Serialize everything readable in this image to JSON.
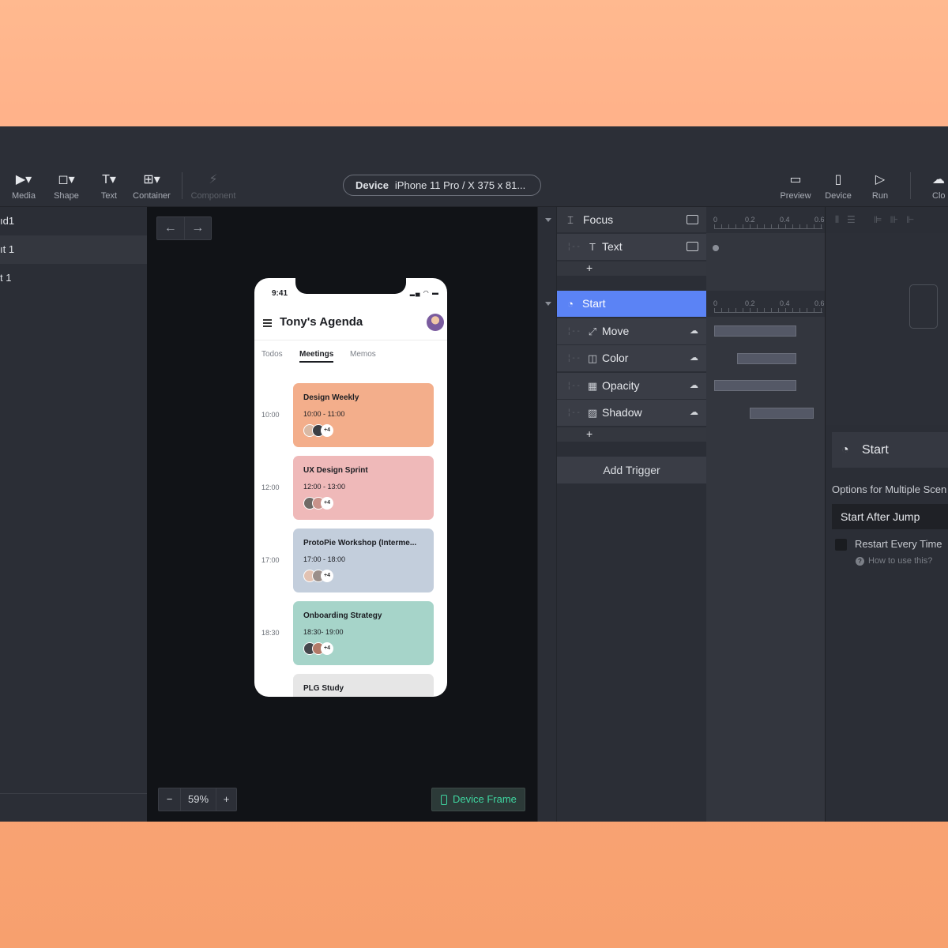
{
  "toolbar": {
    "tools": [
      {
        "label": "Media",
        "icon": "media-icon",
        "glyph": "▶▾"
      },
      {
        "label": "Shape",
        "icon": "shape-icon",
        "glyph": "◻▾"
      },
      {
        "label": "Text",
        "icon": "text-icon",
        "glyph": "T▾"
      },
      {
        "label": "Container",
        "icon": "container-icon",
        "glyph": "⊞▾"
      },
      {
        "label": "Component",
        "icon": "component-icon",
        "glyph": "⚡"
      }
    ],
    "device_label": "Device",
    "device_value": "iPhone 11 Pro / X  375 x 81...",
    "right_tools": [
      {
        "label": "Preview",
        "icon": "preview-icon",
        "glyph": "▭"
      },
      {
        "label": "Device",
        "icon": "device-icon",
        "glyph": "▯"
      },
      {
        "label": "Run",
        "icon": "run-icon",
        "glyph": "▷"
      },
      {
        "label": "Clo",
        "icon": "cloud-icon",
        "glyph": "☁"
      }
    ]
  },
  "layers": [
    "ıd1",
    "ıt 1",
    "t 1"
  ],
  "canvas": {
    "zoom": "59%",
    "zoom_minus": "−",
    "zoom_plus": "+",
    "device_frame": "Device Frame",
    "nav_back": "←",
    "nav_forward": "→"
  },
  "phone": {
    "status_time": "9:41",
    "status_icons": "▂▄ ◠ ▬",
    "title": "Tony's Agenda",
    "tabs": [
      "Todos",
      "Meetings",
      "Memos"
    ],
    "times": [
      "10:00",
      "12:00",
      "17:00",
      "18:30"
    ],
    "cards": [
      {
        "title": "Design Weekly",
        "time": "10:00 - 11:00",
        "more": "+4",
        "color": "#f3ae8b"
      },
      {
        "title": "UX Design Sprint",
        "time": "12:00 - 13:00",
        "more": "+4",
        "color": "#efb9b9"
      },
      {
        "title": "ProtoPie Workshop (Interme...",
        "time": "17:00 - 18:00",
        "more": "+4",
        "color": "#c3cedc"
      },
      {
        "title": "Onboarding Strategy",
        "time": "18:30- 19:00",
        "more": "+4",
        "color": "#a6d4c9"
      },
      {
        "title": "PLG Study",
        "time": "",
        "more": "",
        "color": "#e6e6e6"
      }
    ]
  },
  "timeline": {
    "focus": {
      "label": "Focus",
      "child": "Text",
      "add": "+"
    },
    "start": {
      "label": "Start",
      "add": "+"
    },
    "responses": [
      {
        "label": "Move",
        "icon": "move-icon"
      },
      {
        "label": "Color",
        "icon": "color-icon"
      },
      {
        "label": "Opacity",
        "icon": "opacity-icon"
      },
      {
        "label": "Shadow",
        "icon": "shadow-icon"
      }
    ],
    "add_trigger": "Add Trigger",
    "ruler": [
      "0",
      "0.2",
      "0.4",
      "0.6"
    ]
  },
  "props": {
    "trigger_label": "Start",
    "options_label": "Options for Multiple Scen",
    "select_value": "Start After Jump",
    "restart_label": "Restart Every Time",
    "help_label": "How to use this?",
    "help_icon": "?"
  }
}
